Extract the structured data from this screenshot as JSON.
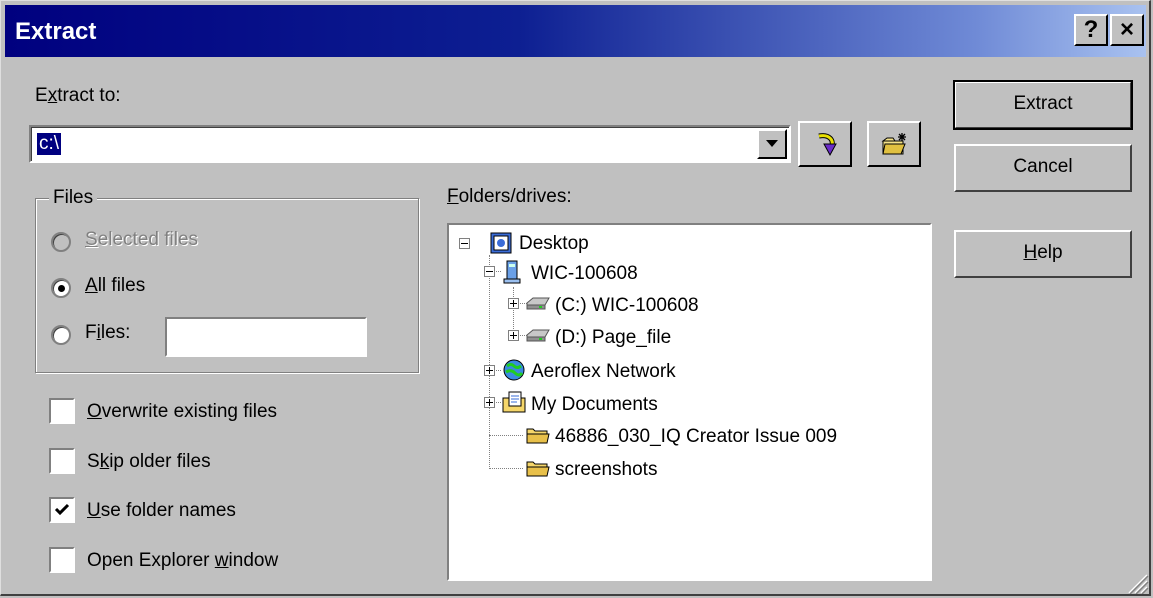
{
  "window": {
    "title": "Extract",
    "help_button": "?",
    "close_button": "×"
  },
  "extract_to": {
    "label_pre": "E",
    "label_accel": "x",
    "label_post": "tract to:",
    "value": "c:\\"
  },
  "files_group": {
    "legend": "Files",
    "selected_files": {
      "accel": "S",
      "rest": "elected files",
      "enabled": false,
      "checked": false
    },
    "all_files": {
      "accel": "A",
      "rest": "ll files",
      "enabled": true,
      "checked": true
    },
    "files": {
      "pre": "F",
      "accel": "i",
      "post": "les:",
      "enabled": true,
      "checked": false,
      "value": ""
    }
  },
  "options": [
    {
      "pre": "",
      "accel": "O",
      "post": "verwrite existing files",
      "checked": false
    },
    {
      "pre": "S",
      "accel": "k",
      "post": "ip older files",
      "checked": false
    },
    {
      "pre": "",
      "accel": "U",
      "post": "se folder names",
      "checked": true
    },
    {
      "pre": "Open Explorer ",
      "accel": "w",
      "post": "indow",
      "checked": false
    }
  ],
  "folders": {
    "label_accel": "F",
    "label_rest": "olders/drives:",
    "items": [
      {
        "label": "Desktop",
        "icon": "desktop-icon"
      },
      {
        "label": "WIC-100608",
        "icon": "computer-icon"
      },
      {
        "label": "(C:) WIC-100608",
        "icon": "drive-icon"
      },
      {
        "label": "(D:) Page_file",
        "icon": "drive-icon"
      },
      {
        "label": "Aeroflex Network",
        "icon": "network-icon"
      },
      {
        "label": "My Documents",
        "icon": "my-documents-icon"
      },
      {
        "label": "46886_030_IQ Creator Issue 009",
        "icon": "folder-icon"
      },
      {
        "label": "screenshots",
        "icon": "folder-icon"
      }
    ]
  },
  "buttons": {
    "extract": "Extract",
    "cancel": "Cancel",
    "help_accel": "H",
    "help_rest": "elp"
  },
  "colors": {
    "title_gradient_start": "#00007f",
    "title_gradient_end": "#a9c2f0",
    "face": "#c0c0c0",
    "selection": "#000080"
  }
}
